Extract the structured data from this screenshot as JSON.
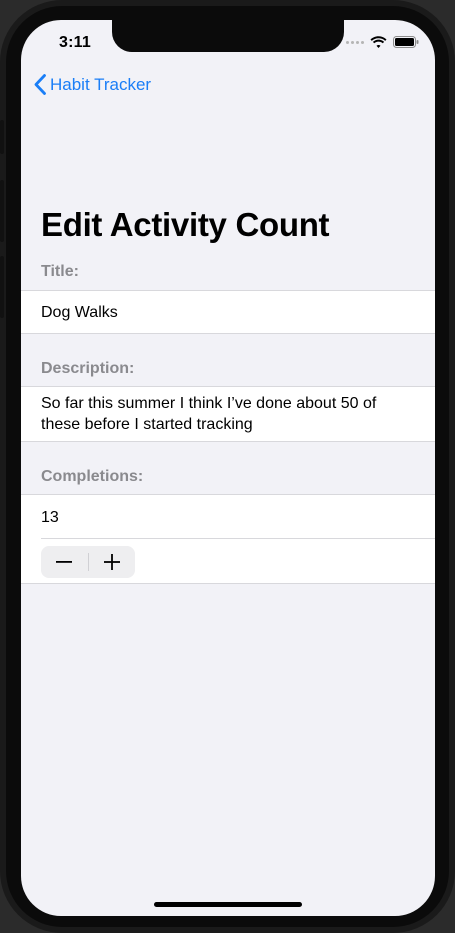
{
  "status_bar": {
    "time": "3:11"
  },
  "nav": {
    "back_label": "Habit Tracker",
    "back_icon": "chevron-left-icon"
  },
  "page": {
    "title": "Edit Activity Count"
  },
  "form": {
    "title_section": {
      "label": "Title:",
      "value": "Dog Walks"
    },
    "description_section": {
      "label": "Description:",
      "value": "So far this summer I think I’ve done about 50 of these before I started tracking"
    },
    "completions_section": {
      "label": "Completions:",
      "value": "13"
    }
  },
  "colors": {
    "accent": "#1a7ef7",
    "background": "#f2f2f7",
    "section_label": "#8a8a8e"
  }
}
